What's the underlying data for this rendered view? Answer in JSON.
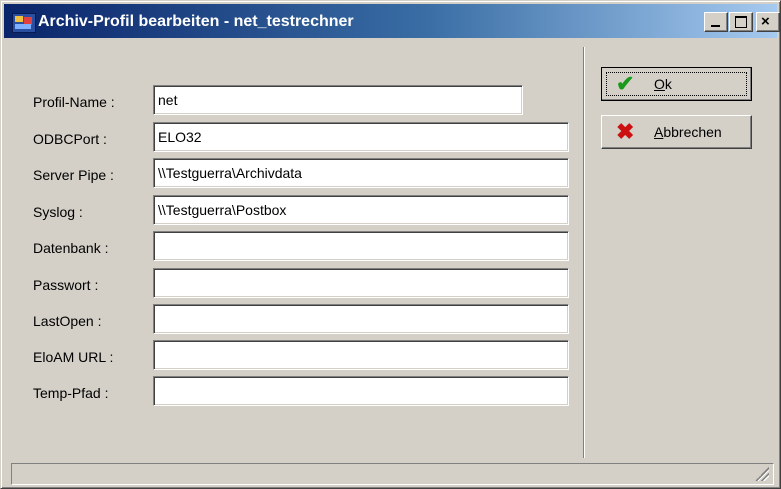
{
  "window": {
    "title": "Archiv-Profil bearbeiten - net_testrechner",
    "close_glyph": "×"
  },
  "form": {
    "fields": [
      {
        "label": "Profil-Name :",
        "value": ""
      },
      {
        "label": "ODBCPort :",
        "value": "ELO32"
      },
      {
        "label": "Server Pipe :",
        "value": "\\\\Testguerra\\Archivdata"
      },
      {
        "label": "Syslog :",
        "value": "\\\\Testguerra\\Postbox"
      },
      {
        "label": "Datenbank :",
        "value": ""
      },
      {
        "label": "Passwort :",
        "value": ""
      },
      {
        "label": "LastOpen :",
        "value": ""
      },
      {
        "label": "EloAM URL :",
        "value": ""
      },
      {
        "label": "Temp-Pfad :",
        "value": ""
      }
    ],
    "profil_name_value": "net"
  },
  "buttons": {
    "ok_label": "Ok",
    "ok_icon": "check-icon",
    "ok_glyph": "✔",
    "cancel_label": "Abbrechen",
    "cancel_icon": "cross-icon",
    "cancel_glyph": "✖"
  },
  "colors": {
    "title_start": "#0a246a",
    "title_end": "#a6caf0",
    "check_green": "#1a9a1a",
    "cross_red": "#cc1010"
  }
}
